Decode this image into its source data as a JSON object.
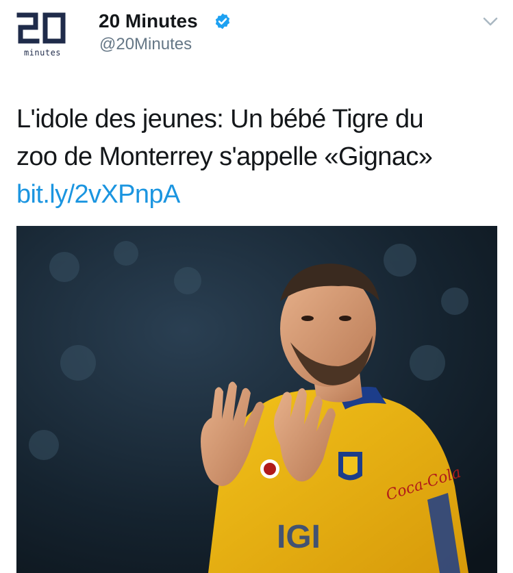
{
  "tweet": {
    "account": {
      "name": "20 Minutes",
      "handle": "@20Minutes",
      "verified": true,
      "logo": {
        "numerals": "20",
        "word": "minutes",
        "color": "#1f2b4a"
      }
    },
    "text_line_1": "L'idole des jeunes: Un bébé Tigre du",
    "text_line_2": "zoo de Monterrey s'appelle «Gignac»",
    "link": "bit.ly/2vXPnpA",
    "media": {
      "type": "photo",
      "jersey_sponsor": "Coca-Cola",
      "jersey_text": "IGI"
    },
    "icons": [
      "verified-badge-icon",
      "chevron-down-icon"
    ],
    "colors": {
      "name": "#14171a",
      "handle": "#657786",
      "link": "#1b95e0",
      "verified": "#1da1f2",
      "chevron": "#aab8c2"
    }
  }
}
